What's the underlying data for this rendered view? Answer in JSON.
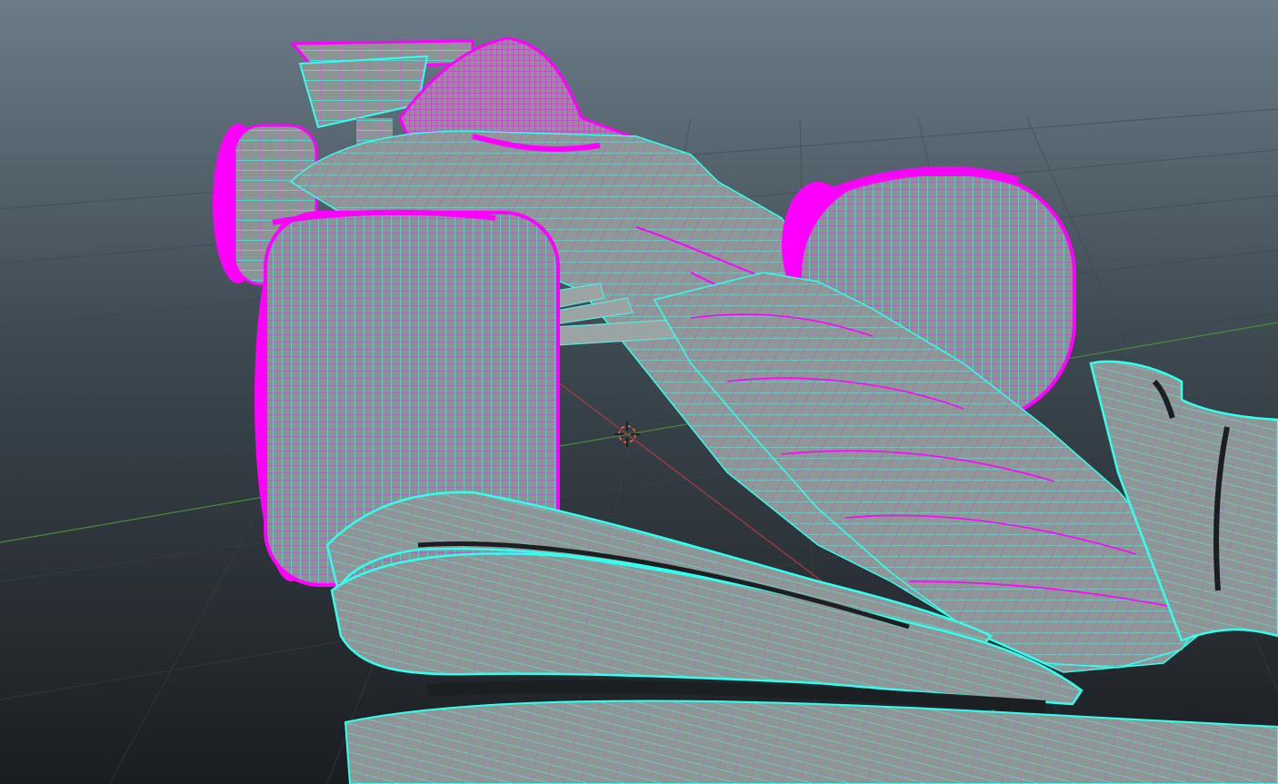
{
  "viewport": {
    "background_top": "#6b7c88",
    "background_bottom": "#1c1f22",
    "grid_color": "#3a4248",
    "axis_x_color": "#b33a3a",
    "axis_z_color": "#4a8a3a"
  },
  "model": {
    "surface_color": "#8b9694",
    "surface_dark": "#6d7775",
    "edge_color_selected": "#ff00ff",
    "edge_color_border": "#33ffee",
    "edge_color_wire": "#7fe5e0",
    "parts": [
      {
        "name": "rear-wing",
        "icon": "mesh-icon"
      },
      {
        "name": "engine-cover",
        "icon": "mesh-icon"
      },
      {
        "name": "rear-left-wheel",
        "icon": "wheel-icon"
      },
      {
        "name": "front-left-wheel",
        "icon": "wheel-icon"
      },
      {
        "name": "front-right-wheel",
        "icon": "wheel-icon"
      },
      {
        "name": "nose-cone",
        "icon": "mesh-icon"
      },
      {
        "name": "front-wing",
        "icon": "mesh-icon"
      },
      {
        "name": "endplate",
        "icon": "mesh-icon"
      }
    ]
  },
  "pivot": {
    "icon": "pivot-crosshair-icon",
    "color": "#ff6a4a"
  }
}
